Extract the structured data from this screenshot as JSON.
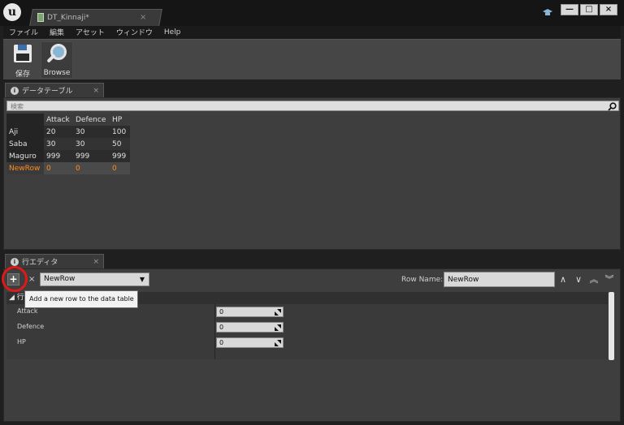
{
  "window": {
    "doc_tab_title": "DT_Kinnaji*",
    "doc_tab_close": "×",
    "minimize": "—",
    "maximize": "□",
    "close": "×"
  },
  "menu": [
    "ファイル",
    "編集",
    "アセット",
    "ウィンドウ",
    "Help"
  ],
  "toolbar": {
    "save_label": "保存",
    "browse_label": "Browse"
  },
  "data_table_panel": {
    "tab_label": "データテーブル",
    "tab_close": "×",
    "search_placeholder": "検索",
    "columns": [
      "Attack",
      "Defence",
      "HP"
    ],
    "rows": [
      {
        "name": "Aji",
        "values": [
          "20",
          "30",
          "100"
        ]
      },
      {
        "name": "Saba",
        "values": [
          "30",
          "30",
          "50"
        ]
      },
      {
        "name": "Maguro",
        "values": [
          "999",
          "999",
          "999"
        ]
      },
      {
        "name": "NewRow",
        "values": [
          "0",
          "0",
          "0"
        ]
      }
    ],
    "selected_row": "NewRow",
    "selected_color": "#ff8a1c"
  },
  "row_editor_panel": {
    "tab_label": "行エディタ",
    "tab_close": "×",
    "add_button": "+",
    "delete_button": "×",
    "row_select_value": "NewRow",
    "row_name_label": "Row Name:",
    "row_name_value": "NewRow",
    "nav": [
      "∧",
      "∨",
      "︽",
      "︾"
    ],
    "tooltip": "Add a new row to the data table",
    "category": "行",
    "properties": [
      {
        "label": "Attack",
        "value": "0"
      },
      {
        "label": "Defence",
        "value": "0"
      },
      {
        "label": "HP",
        "value": "0"
      }
    ],
    "highlight_color": "#e01818"
  }
}
